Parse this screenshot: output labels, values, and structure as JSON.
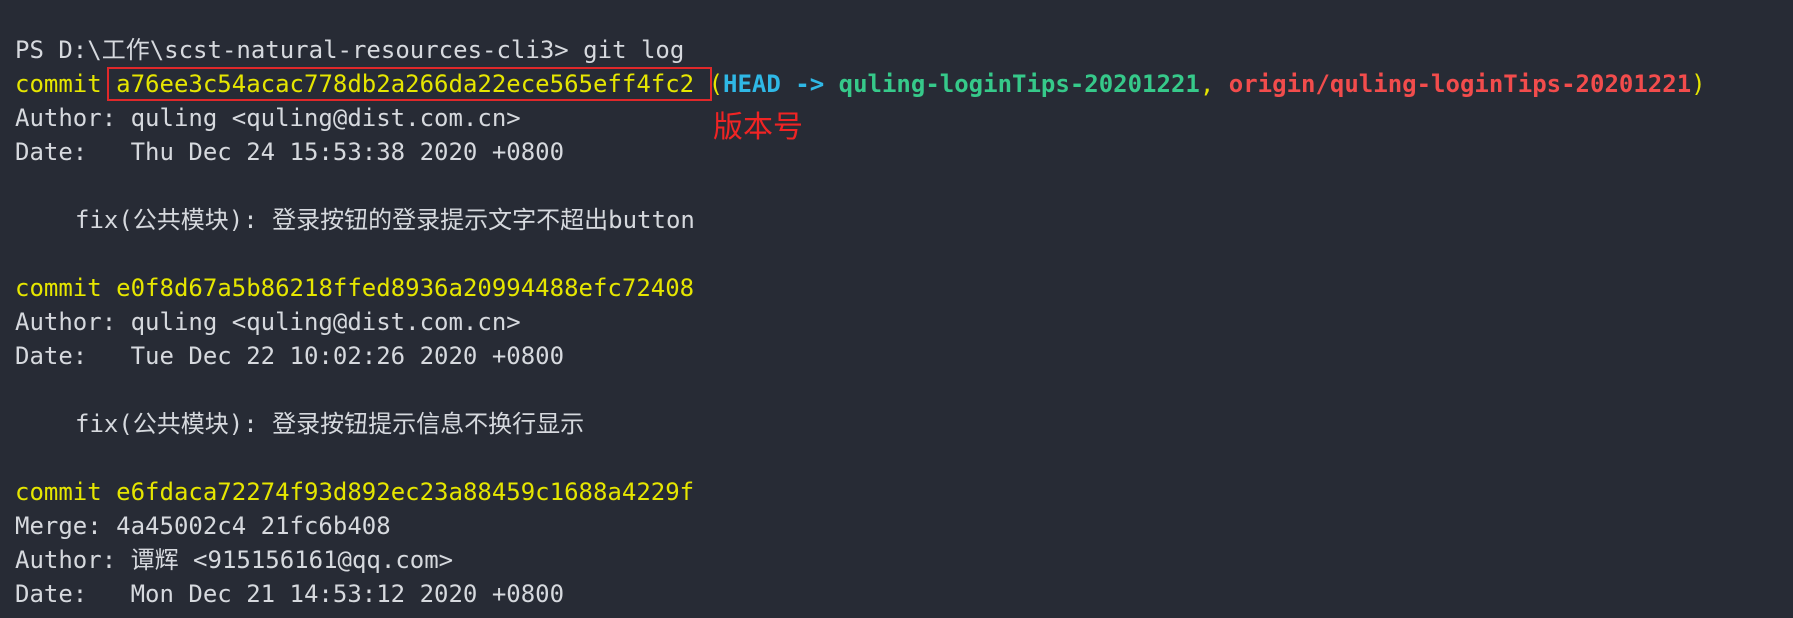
{
  "prompt": {
    "text": "PS D:\\工作\\scst-natural-resources-cli3> git log"
  },
  "commits": [
    {
      "keyword": "commit ",
      "hash": "a76ee3c54acac778db2a266da22ece565eff4fc2",
      "refs": {
        "open": " (",
        "head": "HEAD",
        "arrow": " -> ",
        "branch": "quling-loginTips-20201221",
        "sep": ", ",
        "origin": "origin/quling-loginTips-20201221",
        "close": ")"
      },
      "author": "Author: quling <quling@dist.com.cn>",
      "date": "Date:   Thu Dec 24 15:53:38 2020 +0800",
      "message": "fix(公共模块): 登录按钮的登录提示文字不超出button"
    },
    {
      "keyword": "commit ",
      "hash": "e0f8d67a5b86218ffed8936a20994488efc72408",
      "author": "Author: quling <quling@dist.com.cn>",
      "date": "Date:   Tue Dec 22 10:02:26 2020 +0800",
      "message": "fix(公共模块): 登录按钮提示信息不换行显示"
    },
    {
      "keyword": "commit ",
      "hash": "e6fdaca72274f93d892ec23a88459c1688a4229f",
      "merge": "Merge: 4a45002c4 21fc6b408",
      "author": "Author: 谭辉 <915156161@qq.com>",
      "date": "Date:   Mon Dec 21 14:53:12 2020 +0800"
    }
  ],
  "annotation": {
    "label": "版本号",
    "color": "#e0282a"
  },
  "colors": {
    "background": "#272b35",
    "foreground": "#d6d9de",
    "commit": "#e6e600",
    "head": "#2fb8e6",
    "branch": "#36c98a",
    "remote": "#f24c4c"
  }
}
